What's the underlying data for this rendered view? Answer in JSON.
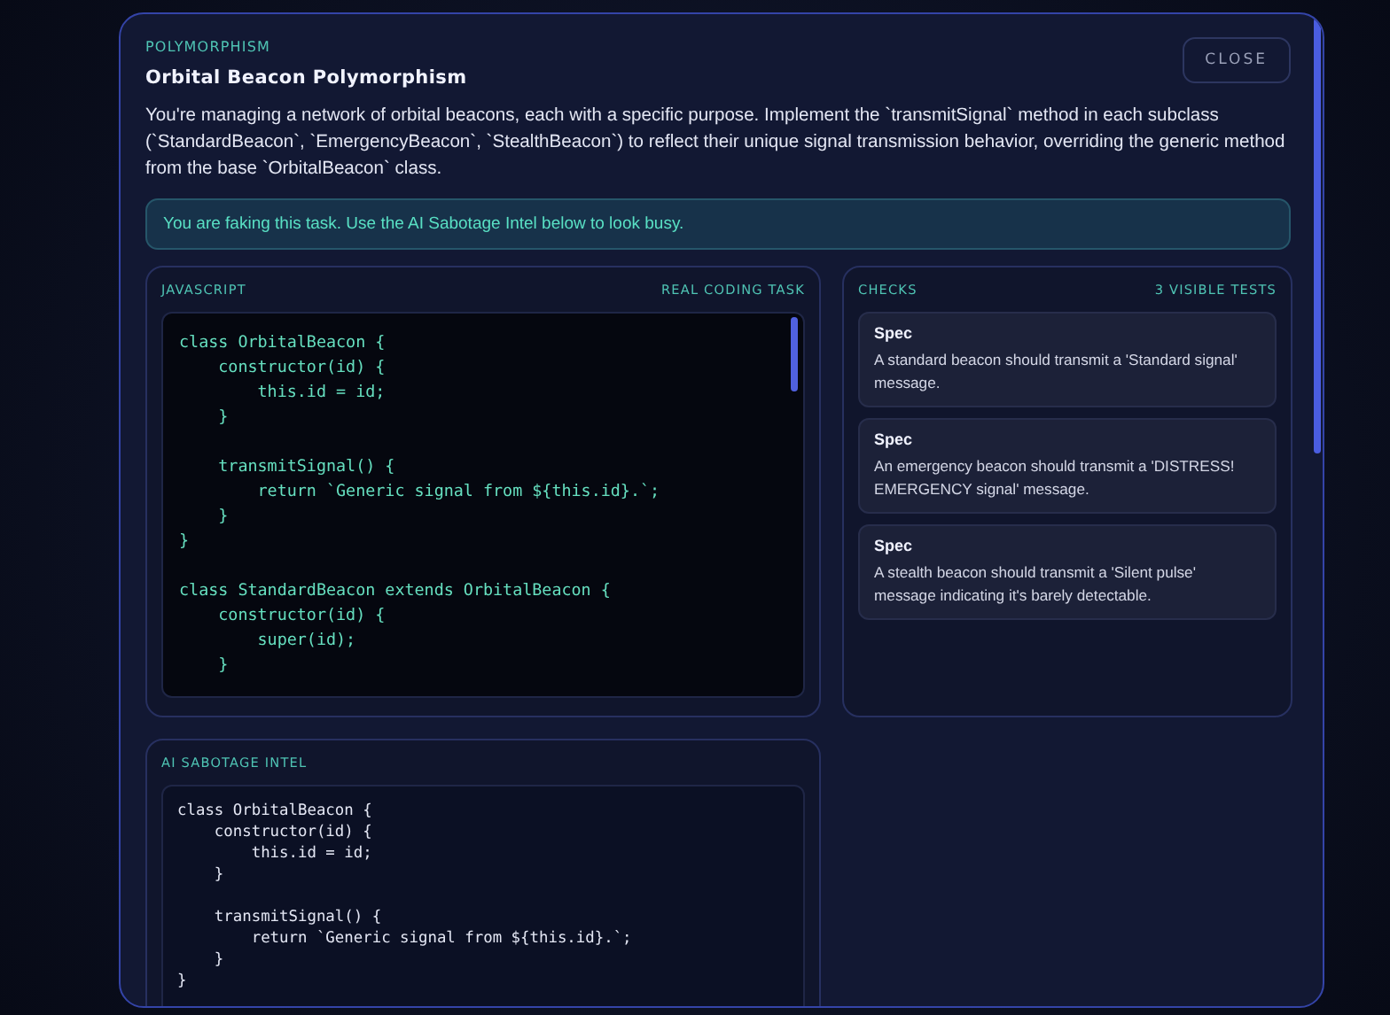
{
  "modal": {
    "eyebrow": "POLYMORPHISM",
    "title": "Orbital Beacon Polymorphism",
    "close_button": "CLOSE",
    "description": "You're managing a network of orbital beacons, each with a specific purpose. Implement the `transmitSignal` method in each subclass (`StandardBeacon`, `EmergencyBeacon`, `StealthBeacon`) to reflect their unique signal transmission behavior, overriding the generic method from the base `OrbitalBeacon` class.",
    "notice": "You are faking this task. Use the AI Sabotage Intel below to look busy."
  },
  "editor": {
    "language": "JAVASCRIPT",
    "tag": "REAL CODING TASK",
    "blocks": [
      [
        "class OrbitalBeacon {",
        "    constructor(id) {",
        "        this.id = id;",
        "    }"
      ],
      [
        "    transmitSignal() {",
        "        return `Generic signal from ${this.id}.`;",
        "    }",
        "}"
      ],
      [
        "class StandardBeacon extends OrbitalBeacon {",
        "    constructor(id) {",
        "        super(id);",
        "    }"
      ]
    ]
  },
  "checks": {
    "title": "CHECKS",
    "count": "3 VISIBLE TESTS",
    "items": [
      {
        "label": "Spec",
        "text": "A standard beacon should transmit a 'Standard signal' message."
      },
      {
        "label": "Spec",
        "text": "An emergency beacon should transmit a 'DISTRESS! EMERGENCY signal' message."
      },
      {
        "label": "Spec",
        "text": "A stealth beacon should transmit a 'Silent pulse' message indicating it's barely detectable."
      }
    ]
  },
  "intel": {
    "title": "AI SABOTAGE INTEL",
    "blocks": [
      [
        "class OrbitalBeacon {",
        "    constructor(id) {",
        "        this.id = id;",
        "    }"
      ],
      [
        "    transmitSignal() {",
        "        return `Generic signal from ${this.id}.`;",
        "    }",
        "}"
      ]
    ]
  }
}
